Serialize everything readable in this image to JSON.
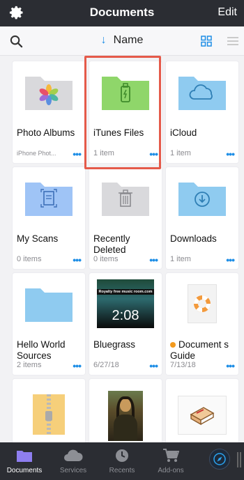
{
  "header": {
    "title": "Documents",
    "edit_label": "Edit"
  },
  "sortbar": {
    "sort_label": "Name",
    "sort_arrow": "↓"
  },
  "items": [
    {
      "name": "Photo Albums",
      "sub": "iPhone Phot...",
      "icon": "photos-folder-icon"
    },
    {
      "name": "iTunes Files",
      "sub": "1 item",
      "icon": "usb-folder-icon"
    },
    {
      "name": "iCloud",
      "sub": "1 item",
      "icon": "cloud-folder-icon"
    },
    {
      "name": "My Scans",
      "sub": "0 items",
      "icon": "scan-folder-icon"
    },
    {
      "name": "Recently Deleted",
      "sub": "0 items",
      "icon": "trash-folder-icon"
    },
    {
      "name": "Downloads",
      "sub": "1 item",
      "icon": "download-folder-icon"
    },
    {
      "name": "Hello World Sources",
      "sub": "2 items",
      "icon": "folder-icon"
    },
    {
      "name": "Bluegrass",
      "sub": "6/27/18",
      "icon": "video-thumbnail",
      "video_banner": "Royalty free music room.com",
      "video_time": "2:08"
    },
    {
      "name": "Document s Guide",
      "sub": "7/13/18",
      "icon": "lifebuoy-icon"
    }
  ],
  "more_glyph": "•••",
  "tabs": [
    {
      "label": "Documents",
      "active": true
    },
    {
      "label": "Services",
      "active": false
    },
    {
      "label": "Recents",
      "active": false
    },
    {
      "label": "Add-ons",
      "active": false
    }
  ],
  "colors": {
    "accent": "#1e8ee6",
    "bar": "#2b2d33",
    "highlight": "#e55a4a",
    "folder_blue": "#8fcbf0",
    "folder_green": "#8fd66a",
    "folder_gray": "#d9d9dc"
  }
}
